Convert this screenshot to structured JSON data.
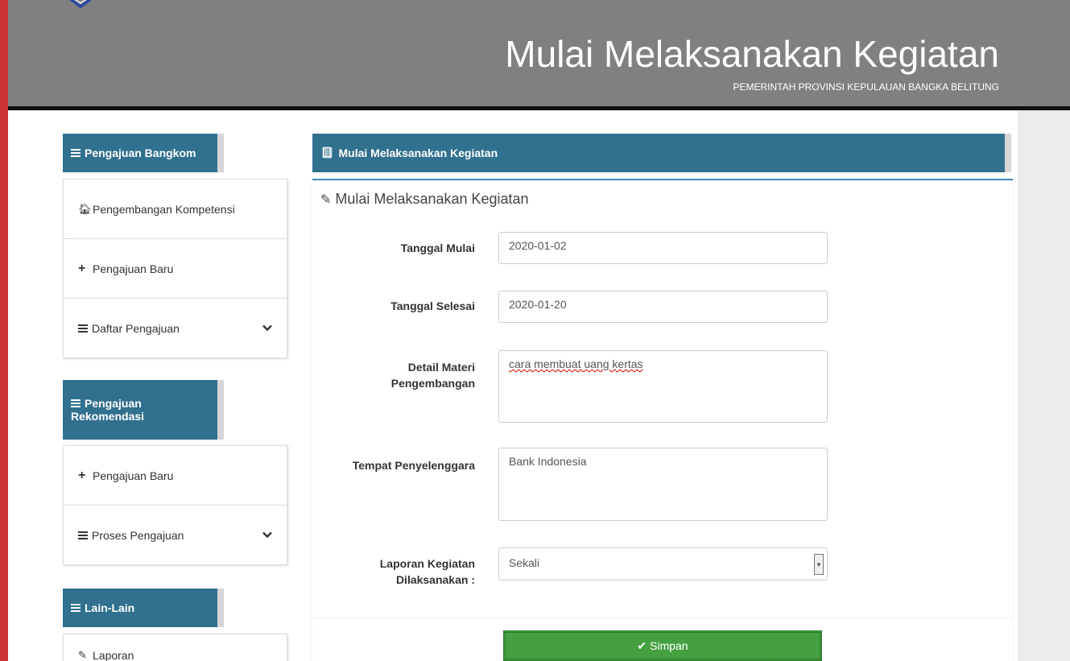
{
  "header": {
    "title": "Mulai Melaksanakan Kegiatan",
    "subtitle": "PEMERINTAH PROVINSI KEPULAUAN BANGKA BELITUNG"
  },
  "sidebar": {
    "sections": [
      {
        "heading": "Pengajuan Bangkom",
        "items": [
          {
            "label": "Pengembangan Kompetensi",
            "icon": "home-icon"
          },
          {
            "label": "Pengajuan Baru",
            "icon": "plus-icon"
          },
          {
            "label": "Daftar Pengajuan",
            "icon": "list-icon",
            "expandable": true
          }
        ]
      },
      {
        "heading_line1": "Pengajuan",
        "heading_line2": "Rekomendasi",
        "items": [
          {
            "label": "Pengajuan Baru",
            "icon": "plus-icon"
          },
          {
            "label": "Proses Pengajuan",
            "icon": "list-icon",
            "expandable": true
          }
        ]
      },
      {
        "heading": "Lain-Lain",
        "items": [
          {
            "label": "Laporan",
            "icon": "edit-icon"
          }
        ]
      }
    ]
  },
  "panel": {
    "heading": "Mulai Melaksanakan Kegiatan",
    "form_title": "Mulai Melaksanakan Kegiatan"
  },
  "form": {
    "tanggal_mulai": {
      "label": "Tanggal Mulai",
      "value": "2020-01-02"
    },
    "tanggal_selesai": {
      "label": "Tanggal Selesai",
      "value": "2020-01-20"
    },
    "detail_materi": {
      "label_line1": "Detail Materi",
      "label_line2": "Pengembangan",
      "value": "cara membuat uang kertas"
    },
    "tempat": {
      "label": "Tempat Penyelenggara",
      "value": "Bank Indonesia"
    },
    "laporan": {
      "label_line1": "Laporan Kegiatan",
      "label_line2": "Dilaksanakan :",
      "value": "Sekali"
    },
    "submit_label": "Simpan"
  },
  "colors": {
    "header_bg": "#808080",
    "panel_blue": "#31708f",
    "save_green": "#45a041"
  }
}
